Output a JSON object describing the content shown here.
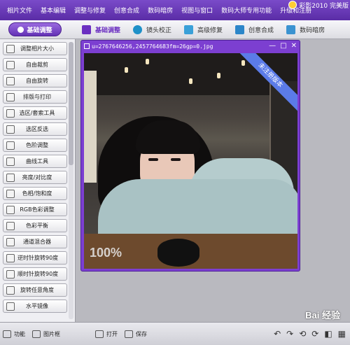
{
  "menu": {
    "items": [
      "相片文件",
      "基本编辑",
      "调整与修复",
      "创意合成",
      "数码暗房",
      "视图与窗口",
      "数码大师专用功能",
      "升级和注册"
    ],
    "app_title": "彩影2010 完美版"
  },
  "toolbar": {
    "mode_label": "基础调整",
    "tabs": [
      "基础调整",
      "镜头校正",
      "高级修复",
      "创意合成",
      "数码暗房"
    ]
  },
  "sidebar": {
    "items": [
      {
        "label": "调整相片大小",
        "icon": "resize-icon"
      },
      {
        "label": "自由裁剪",
        "icon": "crop-icon"
      },
      {
        "label": "自由旋转",
        "icon": "rotate-icon"
      },
      {
        "label": "排版与打印",
        "icon": "print-icon"
      },
      {
        "label": "选区/套索工具",
        "icon": "lasso-icon"
      },
      {
        "label": "选区反选",
        "icon": "invert-selection-icon"
      },
      {
        "label": "色阶调整",
        "icon": "levels-icon"
      },
      {
        "label": "曲线工具",
        "icon": "curves-icon"
      },
      {
        "label": "亮度/对比度",
        "icon": "brightness-icon"
      },
      {
        "label": "色相/饱和度",
        "icon": "hue-icon"
      },
      {
        "label": "RGB色彩调整",
        "icon": "rgb-icon"
      },
      {
        "label": "色彩平衡",
        "icon": "color-balance-icon"
      },
      {
        "label": "通道混合器",
        "icon": "channel-mixer-icon"
      },
      {
        "label": "逆时针旋转90度",
        "icon": "rotate-ccw-icon"
      },
      {
        "label": "顺时针旋转90度",
        "icon": "rotate-cw-icon"
      },
      {
        "label": "旋转任意角度",
        "icon": "rotate-any-icon"
      },
      {
        "label": "水平镜像",
        "icon": "mirror-icon"
      }
    ]
  },
  "image_window": {
    "filename": "u=2767646256,2457764683fm=26gp=0.jpg",
    "zoom": "100%",
    "ribbon": "未注册版本"
  },
  "statusbar": {
    "function_label": "功能",
    "thumbnails_label": "图片框",
    "open_label": "打开",
    "save_label": "保存"
  },
  "watermark": "Bai 经验"
}
